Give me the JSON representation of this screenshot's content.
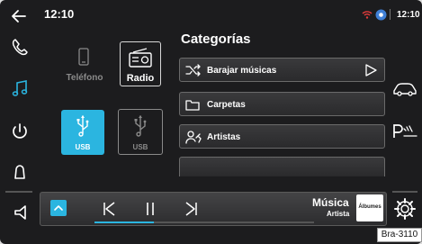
{
  "header": {
    "clock": "12:10",
    "status_time": "12:10"
  },
  "sources": {
    "phone_label": "Teléfono",
    "radio_label": "Radio",
    "usb1_label": "USB",
    "usb2_label": "USB"
  },
  "categories": {
    "title": "Categorías",
    "items": [
      {
        "label": "Barajar músicas"
      },
      {
        "label": "Carpetas"
      },
      {
        "label": "Artistas"
      },
      {
        "label": ""
      }
    ]
  },
  "player": {
    "title": "Música",
    "subtitle": "Artista",
    "album_label": "Álbumes",
    "progress": 0.27
  },
  "image_tag": "Bra-3110",
  "colors": {
    "accent": "#2bb5e0",
    "background": "#1c1c1e",
    "text": "#ffffff"
  }
}
